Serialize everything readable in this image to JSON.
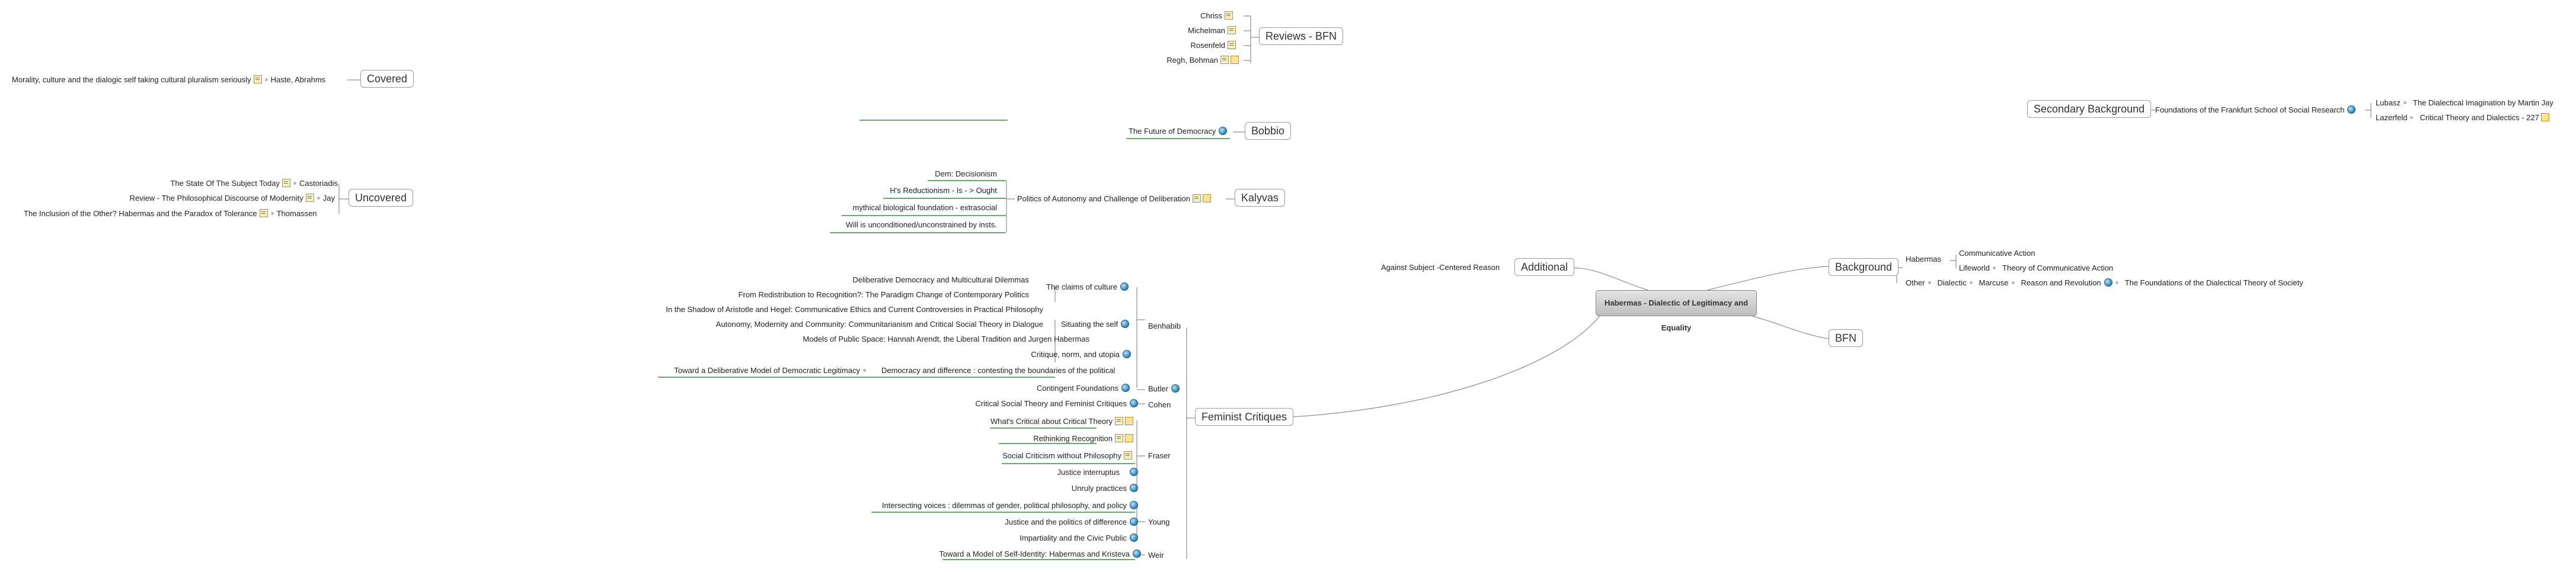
{
  "root": {
    "title": "Habermas - Dialectic of Legitimacy and Equality"
  },
  "reviews": {
    "title": "Reviews - BFN",
    "items": [
      "Chriss",
      "Michelman",
      "Rosenfeld",
      "Regh, Bohman"
    ]
  },
  "covered": {
    "title": "Covered",
    "person": "Haste, Abrahms",
    "work": "Morality, culture and the dialogic self taking cultural pluralism seriously"
  },
  "bobbio": {
    "title": "Bobbio",
    "work": "The Future of Democracy"
  },
  "uncovered": {
    "title": "Uncovered",
    "rows": [
      {
        "work": "The State Of The Subject Today",
        "person": "Castoriadis"
      },
      {
        "work": "Review - The Philosophical Discourse of Modernity",
        "person": "Jay"
      },
      {
        "work": "The Inclusion of the Other? Habermas and the Paradox of Tolerance",
        "person": "Thomassen"
      }
    ]
  },
  "kalyvas": {
    "title": "Kalyvas",
    "work": "Politics of Autonomy and Challenge of Deliberation",
    "points": [
      "Dem: Decisionism",
      "H's Reductionism - Is - > Ought",
      "mythical biological foundation - extrasocial",
      "Will is unconditioned/unconstrained by insts."
    ]
  },
  "secondary": {
    "title": "Secondary Background",
    "work": "Foundations of the Frankfurt School of Social Research",
    "authors": [
      {
        "name": "Lubasz",
        "work": "The Dialectical Imagination by Martin Jay"
      },
      {
        "name": "Lazerfeld",
        "work": "Critical Theory and Dialectics - 227"
      }
    ]
  },
  "additional": {
    "title": "Additional",
    "work": "Against Subject -Centered Reason"
  },
  "background": {
    "title": "Background",
    "habermas": "Habermas",
    "comm": "Communicative Action",
    "lifeworld": "Lifeworld",
    "tca": "Theory of Communicative Action",
    "other": "Other",
    "dialectic": "Dialectic",
    "marcuse": "Marcuse",
    "reason": "Reason and Revolution",
    "foundations": "The Foundations of the Dialectical Theory of Society"
  },
  "bfn": {
    "title": "BFN"
  },
  "feminist": {
    "title": "Feminist Critiques",
    "benhabib": "Benhabib",
    "claims": "The claims of culture",
    "claims_sub": [
      "Deliberative Democracy and Multicultural Dilemmas",
      "From Redistribution to Recognition?: The Paradigm Change of Contemporary Politics"
    ],
    "situating": "Situating the self",
    "situating_sub": [
      "In the Shadow of Aristotle and Hegel: Communicative Ethics and Current Controversies in Practical Philosophy",
      "Autonomy, Modernity and Community: Communitarianism and Critical Social Theory in Dialogue",
      "Models of Public Space: Hannah Arendt, the Liberal Tradition and Jurgen Habermas"
    ],
    "critique": "Critique, norm, and utopia",
    "difference": "Democracy and difference : contesting the boundaries of the political",
    "difference_sub": "Toward a Deliberative Model of Democratic Legitimacy",
    "butler": "Butler",
    "contingent": "Contingent Foundations",
    "cohen": "Cohen",
    "cohen_work": "Critical Social Theory and Feminist Critiques",
    "fraser": "Fraser",
    "fraser_works": [
      "What's Critical about Critical Theory",
      "Rethinking Recognition",
      "Social Criticism without Philosophy",
      "Justice interruptus",
      "Unruly practices"
    ],
    "young": "Young",
    "young_works": [
      "Intersecting voices : dilemmas of gender, political philosophy, and policy",
      "Justice and the politics of difference",
      "Impartiality and the Civic Public"
    ],
    "weir": "Weir",
    "weir_work": "Toward a Model of Self-Identity: Habermas and Kristeva"
  }
}
